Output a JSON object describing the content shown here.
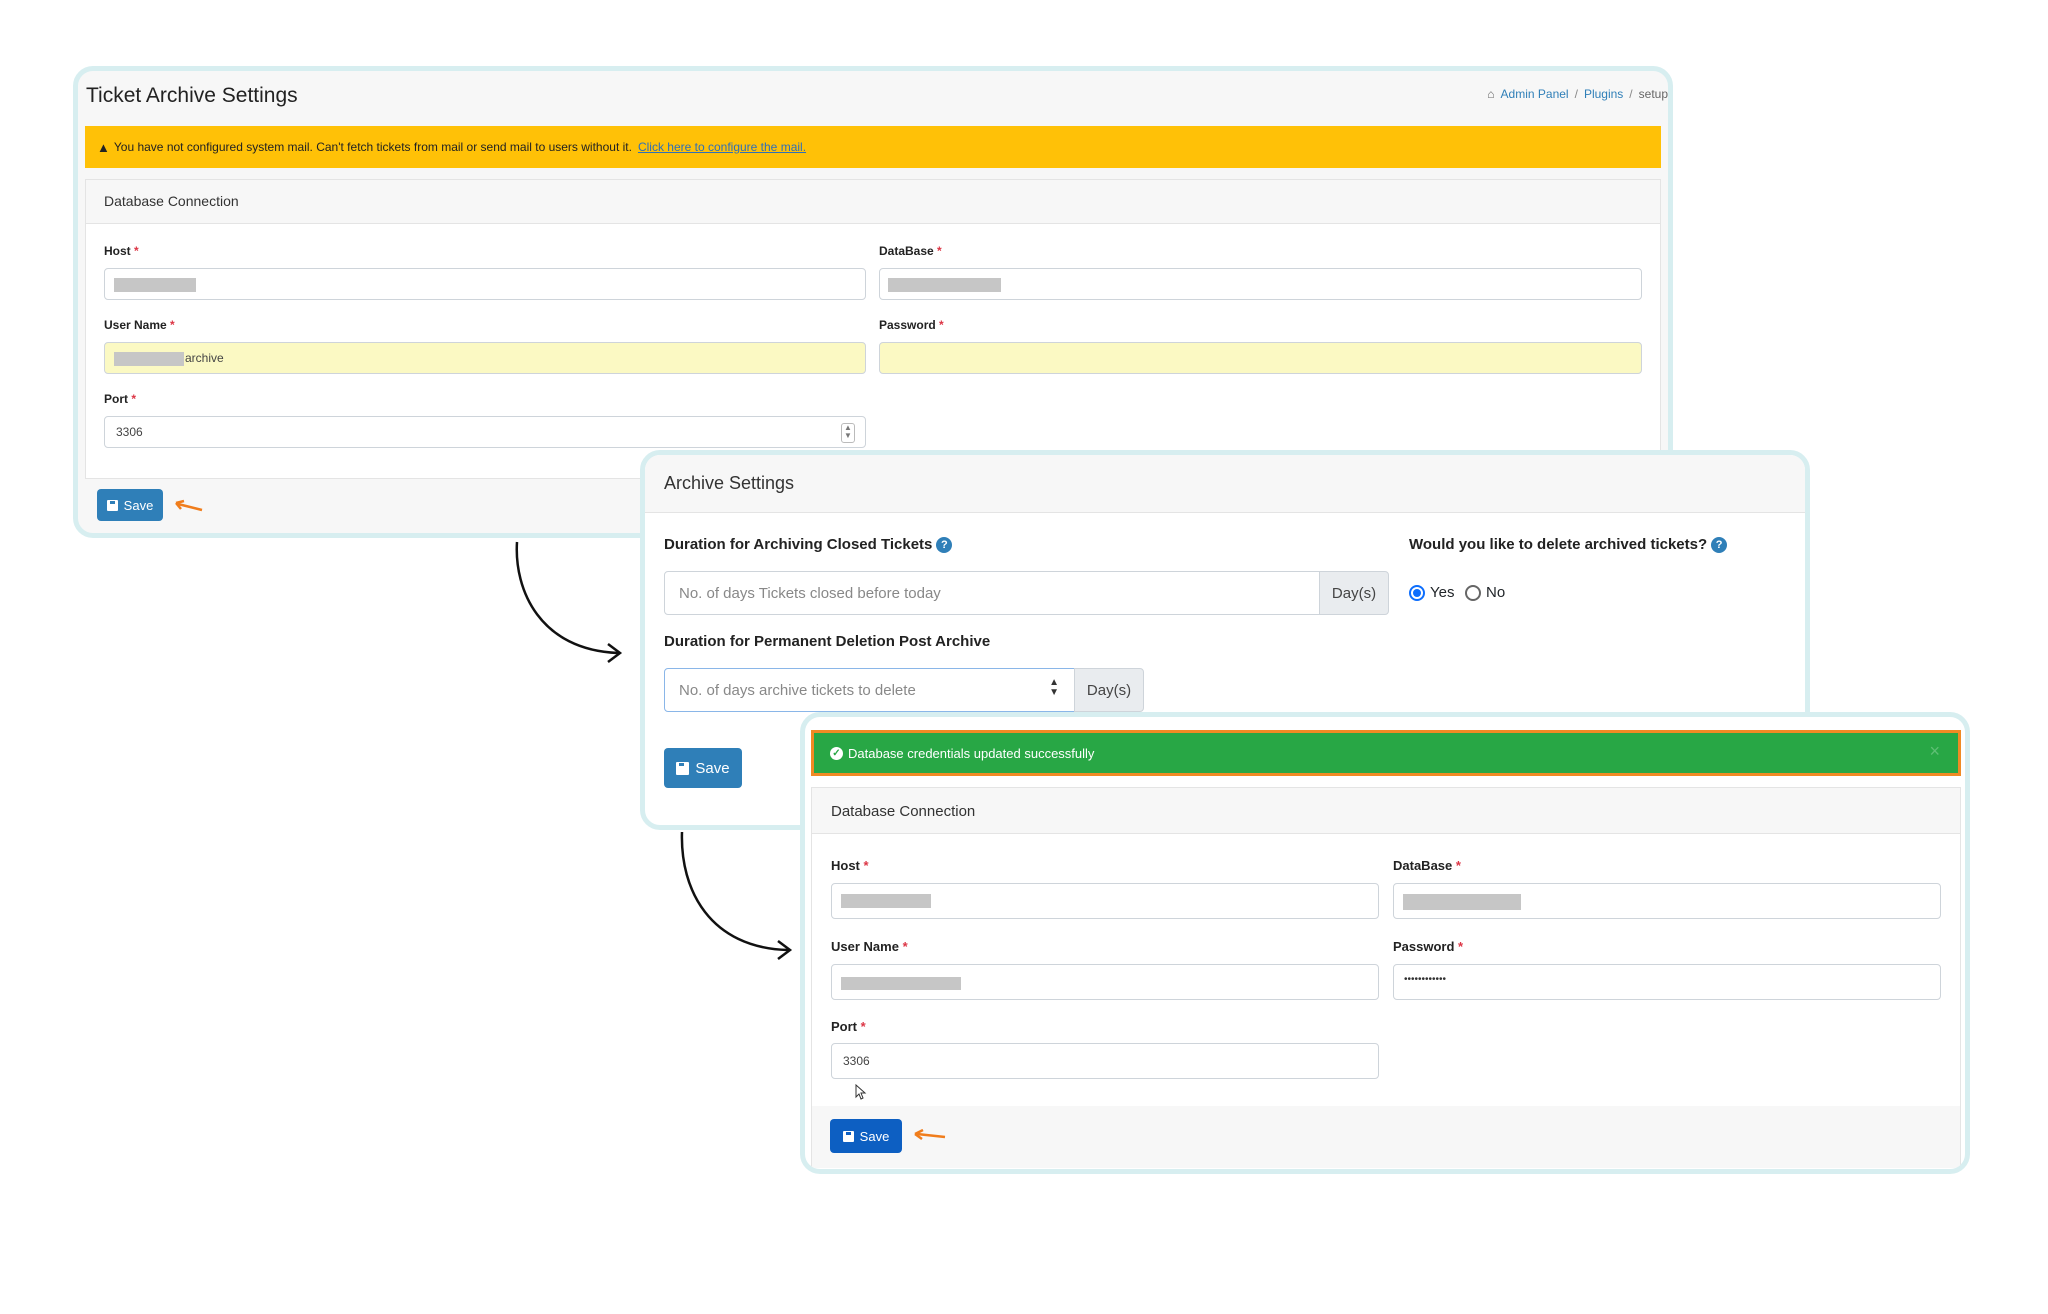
{
  "panel1": {
    "title": "Ticket Archive Settings",
    "breadcrumb": {
      "home": "Admin Panel",
      "sep": "/",
      "plugins": "Plugins",
      "current": "setup"
    },
    "warning": {
      "text": "You have not configured system mail. Can't fetch tickets from mail or send mail to users without it.",
      "link": "Click here to configure the mail."
    },
    "card_title": "Database Connection",
    "host_label": "Host",
    "database_label": "DataBase",
    "username_label": "User Name",
    "username_value": "archive",
    "password_label": "Password",
    "port_label": "Port",
    "port_value": "3306",
    "save_label": "Save",
    "required_mark": "*"
  },
  "panel2": {
    "title": "Archive Settings",
    "closed_label": "Duration for Archiving Closed Tickets",
    "closed_placeholder": "No. of days Tickets closed before today",
    "closed_addon": "Day(s)",
    "delete_question": "Would you like to delete archived tickets?",
    "yes_label": "Yes",
    "no_label": "No",
    "yes_selected": true,
    "perm_label": "Duration for Permanent Deletion Post Archive",
    "perm_placeholder": "No. of days archive tickets to delete",
    "perm_addon": "Day(s)",
    "save_label": "Save"
  },
  "panel3": {
    "success_text": "Database credentials updated successfully",
    "close_glyph": "×",
    "card_title": "Database Connection",
    "host_label": "Host",
    "database_label": "DataBase",
    "username_label": "User Name",
    "password_label": "Password",
    "password_value": "••••••••••••",
    "port_label": "Port",
    "port_value": "3306",
    "save_label": "Save",
    "required_mark": "*"
  },
  "colors": {
    "warning_bg": "#ffc107",
    "success_bg": "#28a745",
    "success_border": "#f08a24",
    "primary": "#2f7fb8",
    "accent_arrow": "#f07d1c"
  }
}
